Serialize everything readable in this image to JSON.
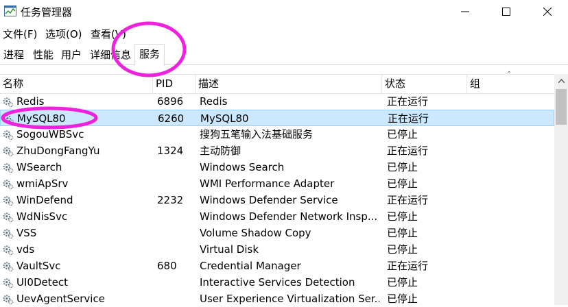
{
  "window": {
    "title": "任务管理器"
  },
  "menu": [
    "文件(F)",
    "选项(O)",
    "查看(V)"
  ],
  "tabs": [
    "进程",
    "性能",
    "用户",
    "详细信息",
    "服务"
  ],
  "active_tab": "服务",
  "columns": {
    "name": "名称",
    "pid": "PID",
    "desc": "描述",
    "status": "状态",
    "group": "组"
  },
  "services": [
    {
      "name": "Redis",
      "pid": "6896",
      "desc": "Redis",
      "status": "正在运行"
    },
    {
      "name": "MySQL80",
      "pid": "6260",
      "desc": "MySQL80",
      "status": "正在运行",
      "selected": true
    },
    {
      "name": "SogouWBSvc",
      "pid": "",
      "desc": "搜狗五笔输入法基础服务",
      "status": "已停止"
    },
    {
      "name": "ZhuDongFangYu",
      "pid": "1324",
      "desc": "主动防御",
      "status": "正在运行"
    },
    {
      "name": "WSearch",
      "pid": "",
      "desc": "Windows Search",
      "status": "已停止"
    },
    {
      "name": "wmiApSrv",
      "pid": "",
      "desc": "WMI Performance Adapter",
      "status": "已停止"
    },
    {
      "name": "WinDefend",
      "pid": "2232",
      "desc": "Windows Defender Service",
      "status": "正在运行"
    },
    {
      "name": "WdNisSvc",
      "pid": "",
      "desc": "Windows Defender Network Insp...",
      "status": "已停止"
    },
    {
      "name": "VSS",
      "pid": "",
      "desc": "Volume Shadow Copy",
      "status": "已停止"
    },
    {
      "name": "vds",
      "pid": "",
      "desc": "Virtual Disk",
      "status": "已停止"
    },
    {
      "name": "VaultSvc",
      "pid": "680",
      "desc": "Credential Manager",
      "status": "正在运行"
    },
    {
      "name": "UI0Detect",
      "pid": "",
      "desc": "Interactive Services Detection",
      "status": "已停止"
    },
    {
      "name": "UevAgentService",
      "pid": "",
      "desc": "User Experience Virtualization Ser...",
      "status": "已停止"
    }
  ],
  "colors": {
    "selection": "#cce8ff",
    "selection_border": "#99d1ff",
    "annotation": "#ee22dd"
  }
}
